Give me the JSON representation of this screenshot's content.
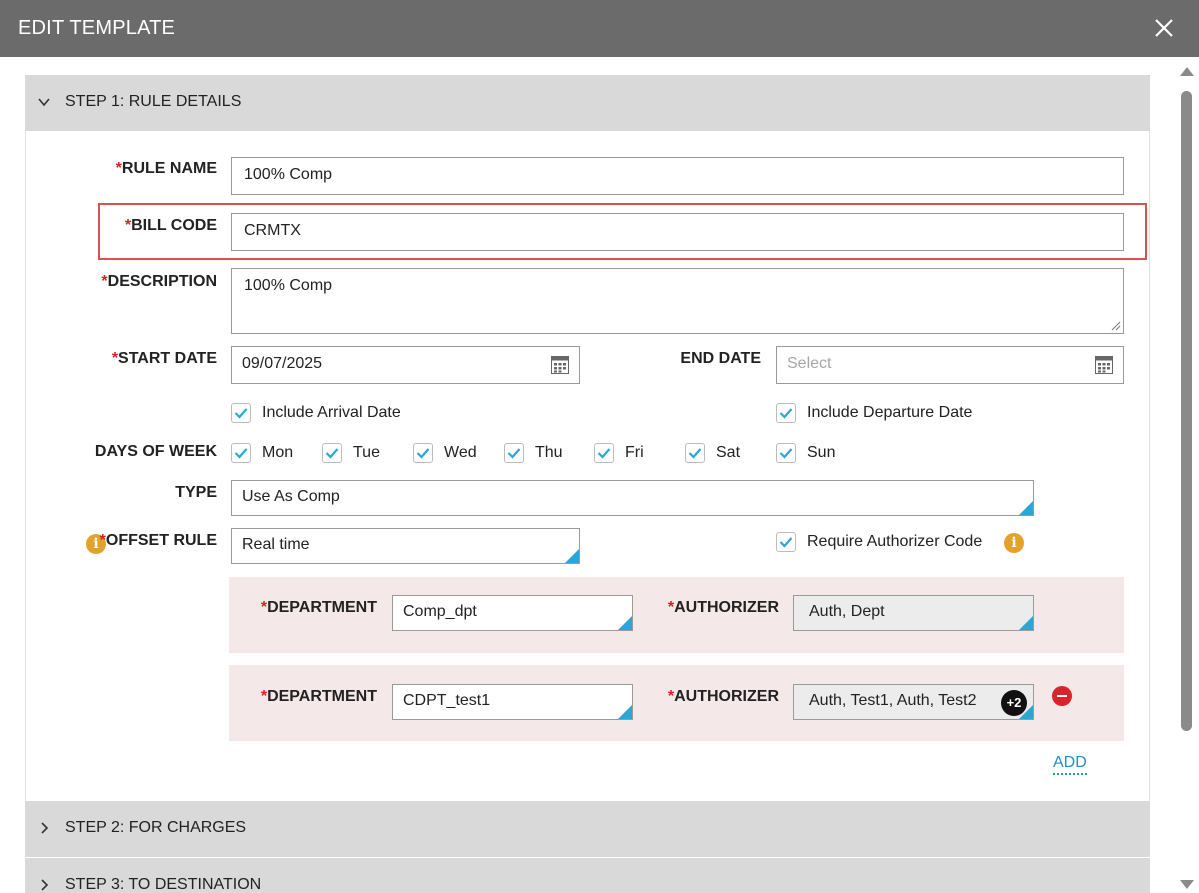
{
  "window": {
    "title": "EDIT TEMPLATE"
  },
  "steps": {
    "step1": "STEP 1: RULE DETAILS",
    "step2": "STEP 2: FOR CHARGES",
    "step3": "STEP 3: TO DESTINATION"
  },
  "form": {
    "required_mark": "*",
    "rule_name": {
      "label": "RULE NAME",
      "value": "100% Comp"
    },
    "bill_code": {
      "label": "BILL CODE",
      "value": "CRMTX"
    },
    "description": {
      "label": "DESCRIPTION",
      "value": "100% Comp"
    },
    "start_date": {
      "label": "START DATE",
      "value": "09/07/2025"
    },
    "end_date": {
      "label": "END DATE",
      "placeholder": "Select"
    },
    "include_arrival": {
      "label": "Include Arrival Date",
      "checked": true
    },
    "include_departure": {
      "label": "Include Departure Date",
      "checked": true
    },
    "days_of_week": {
      "label": "DAYS OF WEEK",
      "days": [
        {
          "label": "Mon",
          "checked": true
        },
        {
          "label": "Tue",
          "checked": true
        },
        {
          "label": "Wed",
          "checked": true
        },
        {
          "label": "Thu",
          "checked": true
        },
        {
          "label": "Fri",
          "checked": true
        },
        {
          "label": "Sat",
          "checked": true
        },
        {
          "label": "Sun",
          "checked": true
        }
      ]
    },
    "type": {
      "label": "TYPE",
      "value": "Use As Comp"
    },
    "offset_rule": {
      "label": "OFFSET RULE",
      "value": "Real time"
    },
    "require_authorizer": {
      "label": "Require Authorizer Code",
      "checked": true
    },
    "department_rows": [
      {
        "dept_label": "DEPARTMENT",
        "dept_value": "Comp_dpt",
        "auth_label": "AUTHORIZER",
        "auth_value": "Auth, Dept"
      },
      {
        "dept_label": "DEPARTMENT",
        "dept_value": "CDPT_test1",
        "auth_label": "AUTHORIZER",
        "auth_value": "Auth, Test1, Auth, Test2",
        "extra_count": "+2"
      }
    ],
    "add_label": "ADD"
  },
  "colors": {
    "titlebar": "#6b6b6b",
    "accent": "#2aa7d6",
    "highlight_border": "#d9534f",
    "required": "#d92020",
    "info": "#e3a32b",
    "remove": "#d9232d"
  },
  "icons": [
    "close-icon",
    "chevron-down-icon",
    "chevron-right-icon",
    "calendar-icon",
    "checkmark-icon",
    "info-icon",
    "remove-icon"
  ]
}
